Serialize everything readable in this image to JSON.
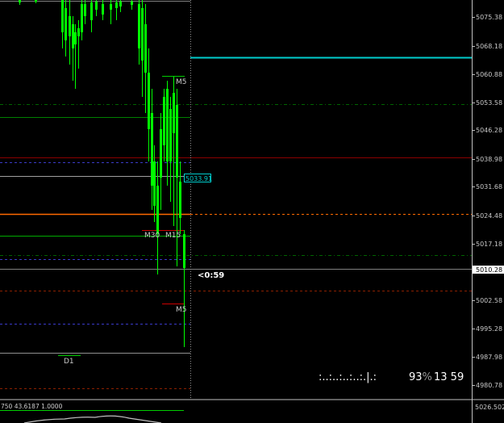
{
  "price_axis": {
    "labels": [
      "5075.38",
      "5068.18",
      "5060.88",
      "5053.58",
      "5046.28",
      "5038.98",
      "5031.68",
      "5024.48",
      "5017.18",
      "5002.58",
      "4995.28",
      "4987.98",
      "4980.78"
    ],
    "current_price": "5010.28"
  },
  "indicator": {
    "params": "750 43.6187 1.0000",
    "axis_value": "5026.5023"
  },
  "price_tag": "5033.91",
  "bar_timer": "<0:59",
  "timeframe_labels": {
    "m5_upper": "M5",
    "m30": "M30",
    "m15": "M15",
    "m5_lower": "M5",
    "d1": "D1"
  },
  "info_panel": {
    "dots": ":..:..:..:..:.|.:",
    "percent_value": "93",
    "percent_sign": "%",
    "numbers": "13 59"
  },
  "colors": {
    "background": "#000000",
    "candle": "#00ff00",
    "cyan_level": "#00cccc",
    "orange_level": "#ff6a00",
    "red_level": "#8b0000",
    "green_level": "#008000",
    "gray_level": "#a0a0a0"
  }
}
